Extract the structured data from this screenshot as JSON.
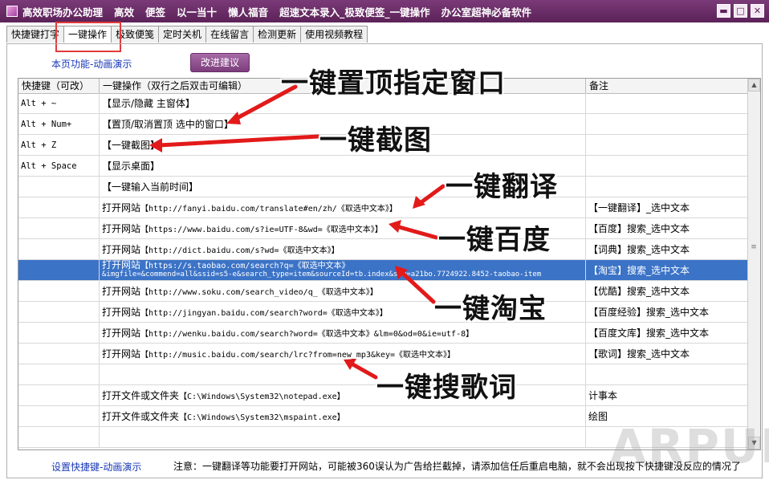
{
  "title_bar": {
    "menu": [
      "高效职场办公助理",
      "高效",
      "便签",
      "以一当十",
      "懒人福音",
      "超速文本录入_极致便签_一键操作",
      "办公室超神必备软件"
    ],
    "controls": [
      "▬",
      "□",
      "✕"
    ]
  },
  "tabs": [
    {
      "label": "快捷键打字",
      "active": false
    },
    {
      "label": "一键操作",
      "active": true
    },
    {
      "label": "极致便笺",
      "active": false
    },
    {
      "label": "定时关机",
      "active": false
    },
    {
      "label": "在线留言",
      "active": false
    },
    {
      "label": "检测更新",
      "active": false
    },
    {
      "label": "使用视频教程",
      "active": false
    }
  ],
  "page_demo_link": "本页功能-动画演示",
  "suggest_button": "改进建议",
  "table": {
    "headers": [
      "快捷键（可改）",
      "一键操作（双行之后双击可编辑）",
      "备注"
    ],
    "rows": [
      {
        "key": "Alt + ~",
        "action": "【显示/隐藏 主窗体】",
        "note": "",
        "selected": false
      },
      {
        "key": "Alt + Num+",
        "action": "【置顶/取消置顶 选中的窗口】",
        "note": "",
        "selected": false
      },
      {
        "key": "Alt + Z",
        "action": "【一键截图】",
        "note": "",
        "selected": false
      },
      {
        "key": "Alt + Space",
        "action": "【显示桌面】",
        "note": "",
        "selected": false
      },
      {
        "key": "",
        "action": "【一键输入当前时间】",
        "note": "",
        "selected": false
      },
      {
        "key": "",
        "prefix": "打开网站",
        "url": "【http://fanyi.baidu.com/translate#en/zh/《取选中文本》】",
        "note": "【一键翻译】_选中文本",
        "selected": false
      },
      {
        "key": "",
        "prefix": "打开网站",
        "url": "【https://www.baidu.com/s?ie=UTF-8&wd=《取选中文本》】",
        "note": "【百度】搜索_选中文本",
        "selected": false
      },
      {
        "key": "",
        "prefix": "打开网站",
        "url": "【http://dict.baidu.com/s?wd=《取选中文本》】",
        "note": "【词典】搜索_选中文本",
        "selected": false
      },
      {
        "key": "",
        "prefix": "打开网站",
        "url": "【https://s.taobao.com/search?q=《取选中文本》",
        "url2": "&imgfile=&commend=all&ssid=s5-e&search_type=item&sourceId=tb.index&spm=a21bo.7724922.8452-taobao-item",
        "note": "【淘宝】搜索_选中文本",
        "selected": true
      },
      {
        "key": "",
        "prefix": "打开网站",
        "url": "【http://www.soku.com/search_video/q_《取选中文本》】",
        "note": "【优酷】搜索_选中文本",
        "selected": false
      },
      {
        "key": "",
        "prefix": "打开网站",
        "url": "【http://jingyan.baidu.com/search?word=《取选中文本》】",
        "note": "【百度经验】搜索_选中文本",
        "selected": false
      },
      {
        "key": "",
        "prefix": "打开网站",
        "url": "【http://wenku.baidu.com/search?word=《取选中文本》&lm=0&od=0&ie=utf-8】",
        "note": "【百度文库】搜索_选中文本",
        "selected": false
      },
      {
        "key": "",
        "prefix": "打开网站",
        "url": "【http://music.baidu.com/search/lrc?from=new_mp3&key=《取选中文本》】",
        "note": "【歌词】搜索_选中文本",
        "selected": false
      },
      {
        "key": "",
        "action": "",
        "note": "",
        "selected": false
      },
      {
        "key": "",
        "prefix": "打开文件或文件夹",
        "url": "【C:\\Windows\\System32\\notepad.exe】",
        "note": "计事本",
        "selected": false
      },
      {
        "key": "",
        "prefix": "打开文件或文件夹",
        "url": "【C:\\Windows\\System32\\mspaint.exe】",
        "note": "绘图",
        "selected": false
      },
      {
        "key": "",
        "action": "",
        "note": "",
        "selected": false
      }
    ]
  },
  "annotations": {
    "a1": "一键置顶指定窗口",
    "a2": "一键截图",
    "a3": "一键翻译",
    "a4": "一键百度",
    "a5": "一键淘宝",
    "a6": "一键搜歌词"
  },
  "bottom": {
    "hotkey_demo_link": "设置快捷键-动画演示",
    "notice": "注意：一键翻译等功能要打开网站，可能被360误认为广告给拦截掉，请添加信任后重启电脑，就不会出现按下快捷键没反应的情况了"
  },
  "watermark": "ARPUN",
  "colors": {
    "title_bar": "#5c2258",
    "selection": "#3b73c7",
    "link": "#1a38b8",
    "highlight_box": "#e23a3a"
  }
}
